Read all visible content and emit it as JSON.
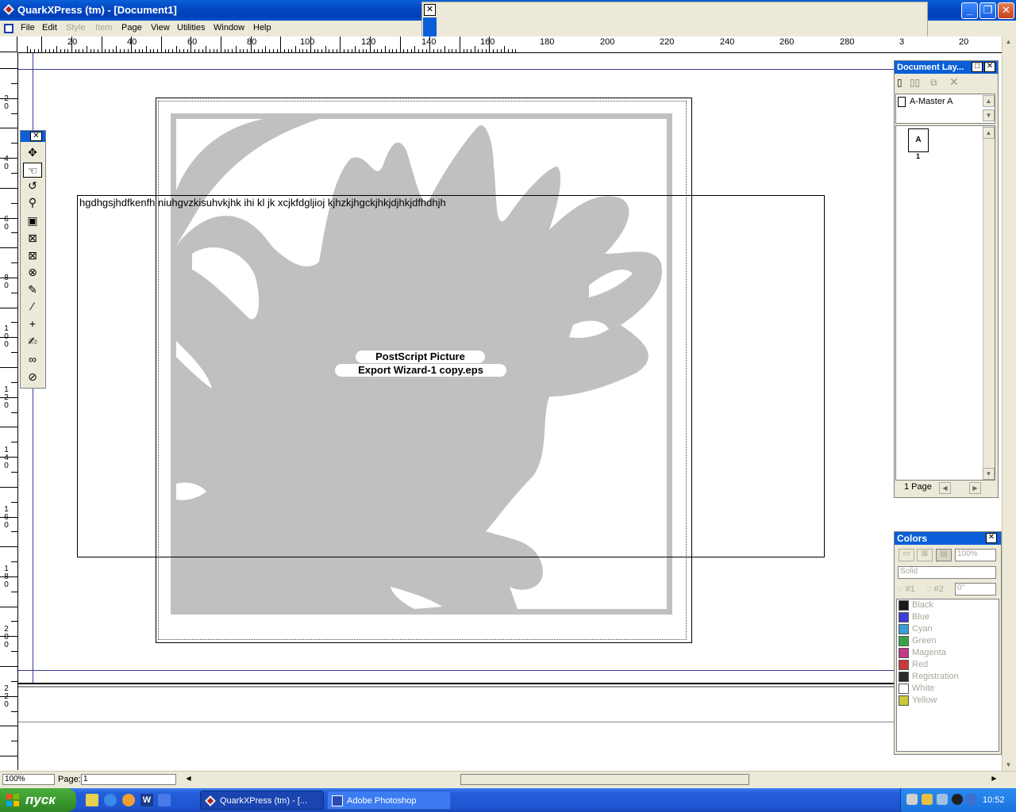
{
  "window": {
    "title": "QuarkXPress (tm) - [Document1]"
  },
  "menu": {
    "items": [
      "File",
      "Edit",
      "Style",
      "Item",
      "Page",
      "View",
      "Utilities",
      "Window",
      "Help"
    ],
    "disabled": [
      "Style",
      "Item"
    ]
  },
  "ruler": {
    "h_labels": [
      "20",
      "40",
      "60",
      "80",
      "100",
      "120",
      "140",
      "160",
      "180",
      "200",
      "220",
      "240",
      "260",
      "280",
      "3",
      "20"
    ],
    "v_labels": [
      "2\n0",
      "4\n0",
      "6\n0",
      "8\n0",
      "1\n0\n0",
      "1\n2\n0",
      "1\n4\n0",
      "1\n6\n0",
      "1\n8\n0",
      "2\n0\n0",
      "2\n2\n0"
    ]
  },
  "document": {
    "text_content": "hgdhgsjhdfkenfh               niuhgvzkisuhvkjhk                          ihi              kl jk     xcjkfdgljioj kjhzkjhgckjhkjdjhkjdfhdhjh",
    "picture_label_line1": "PostScript Picture",
    "picture_label_line2": "Export Wizard-1 copy.eps"
  },
  "layout_palette": {
    "title": "Document Lay...",
    "master_item": "A-Master A",
    "page_letter": "A",
    "page_number": "1",
    "page_count": "1 Page"
  },
  "colors_palette": {
    "title": "Colors",
    "shade": "100%",
    "fill_type": "Solid",
    "radio1": "#1",
    "radio2": "#2",
    "angle": "0°",
    "colors": [
      {
        "name": "Black",
        "hex": "#1a1a1a"
      },
      {
        "name": "Blue",
        "hex": "#3d3dd6"
      },
      {
        "name": "Cyan",
        "hex": "#3a9ed6"
      },
      {
        "name": "Green",
        "hex": "#3aa34a"
      },
      {
        "name": "Magenta",
        "hex": "#c03a8a"
      },
      {
        "name": "Red",
        "hex": "#c83a3a"
      },
      {
        "name": "Registration",
        "hex": "#2a2a2a"
      },
      {
        "name": "White",
        "hex": "#ffffff"
      },
      {
        "name": "Yellow",
        "hex": "#c8c83a"
      }
    ]
  },
  "status": {
    "zoom": "100%",
    "page_label": "Page:",
    "page_value": "1"
  },
  "taskbar": {
    "start": "пуск",
    "tasks": [
      "QuarkXPress (tm) - [...",
      "Adobe Photoshop"
    ],
    "clock": "10:52"
  }
}
